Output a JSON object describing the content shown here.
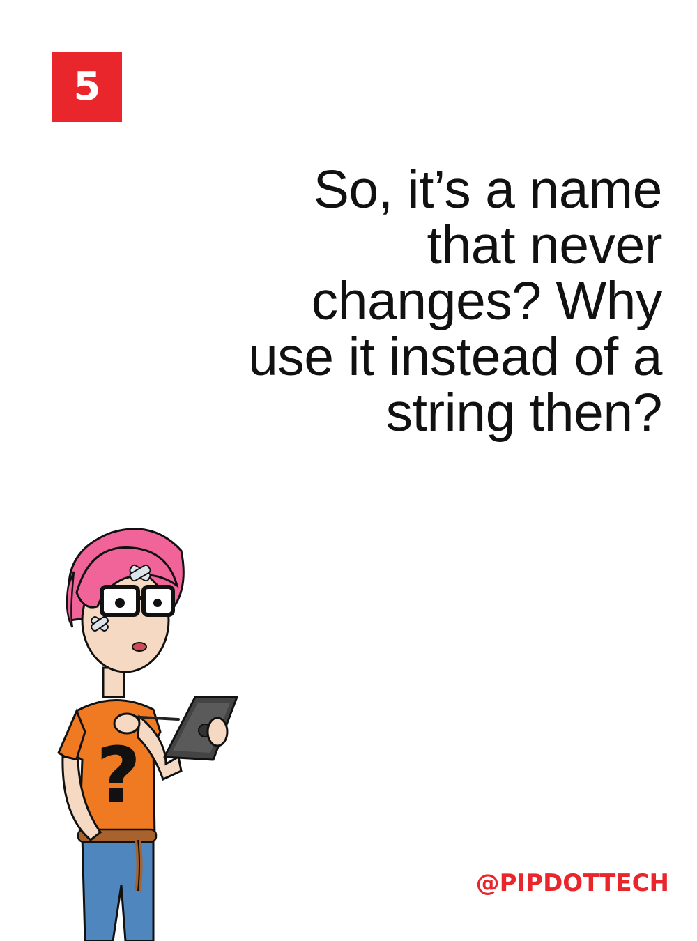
{
  "badge": {
    "number": "5"
  },
  "quote": {
    "lines": [
      "So, it’s a name",
      "that never",
      "changes? Why",
      "use it instead of a",
      "string then?"
    ]
  },
  "handle": "@PIPDOTTECH",
  "colors": {
    "accent": "#e8262c",
    "text": "#111111",
    "hair": "#f0649a",
    "shirt": "#f07a22",
    "jeans": "#4f86bd"
  },
  "illustration": {
    "icon": "confused-developer-with-tablet"
  }
}
